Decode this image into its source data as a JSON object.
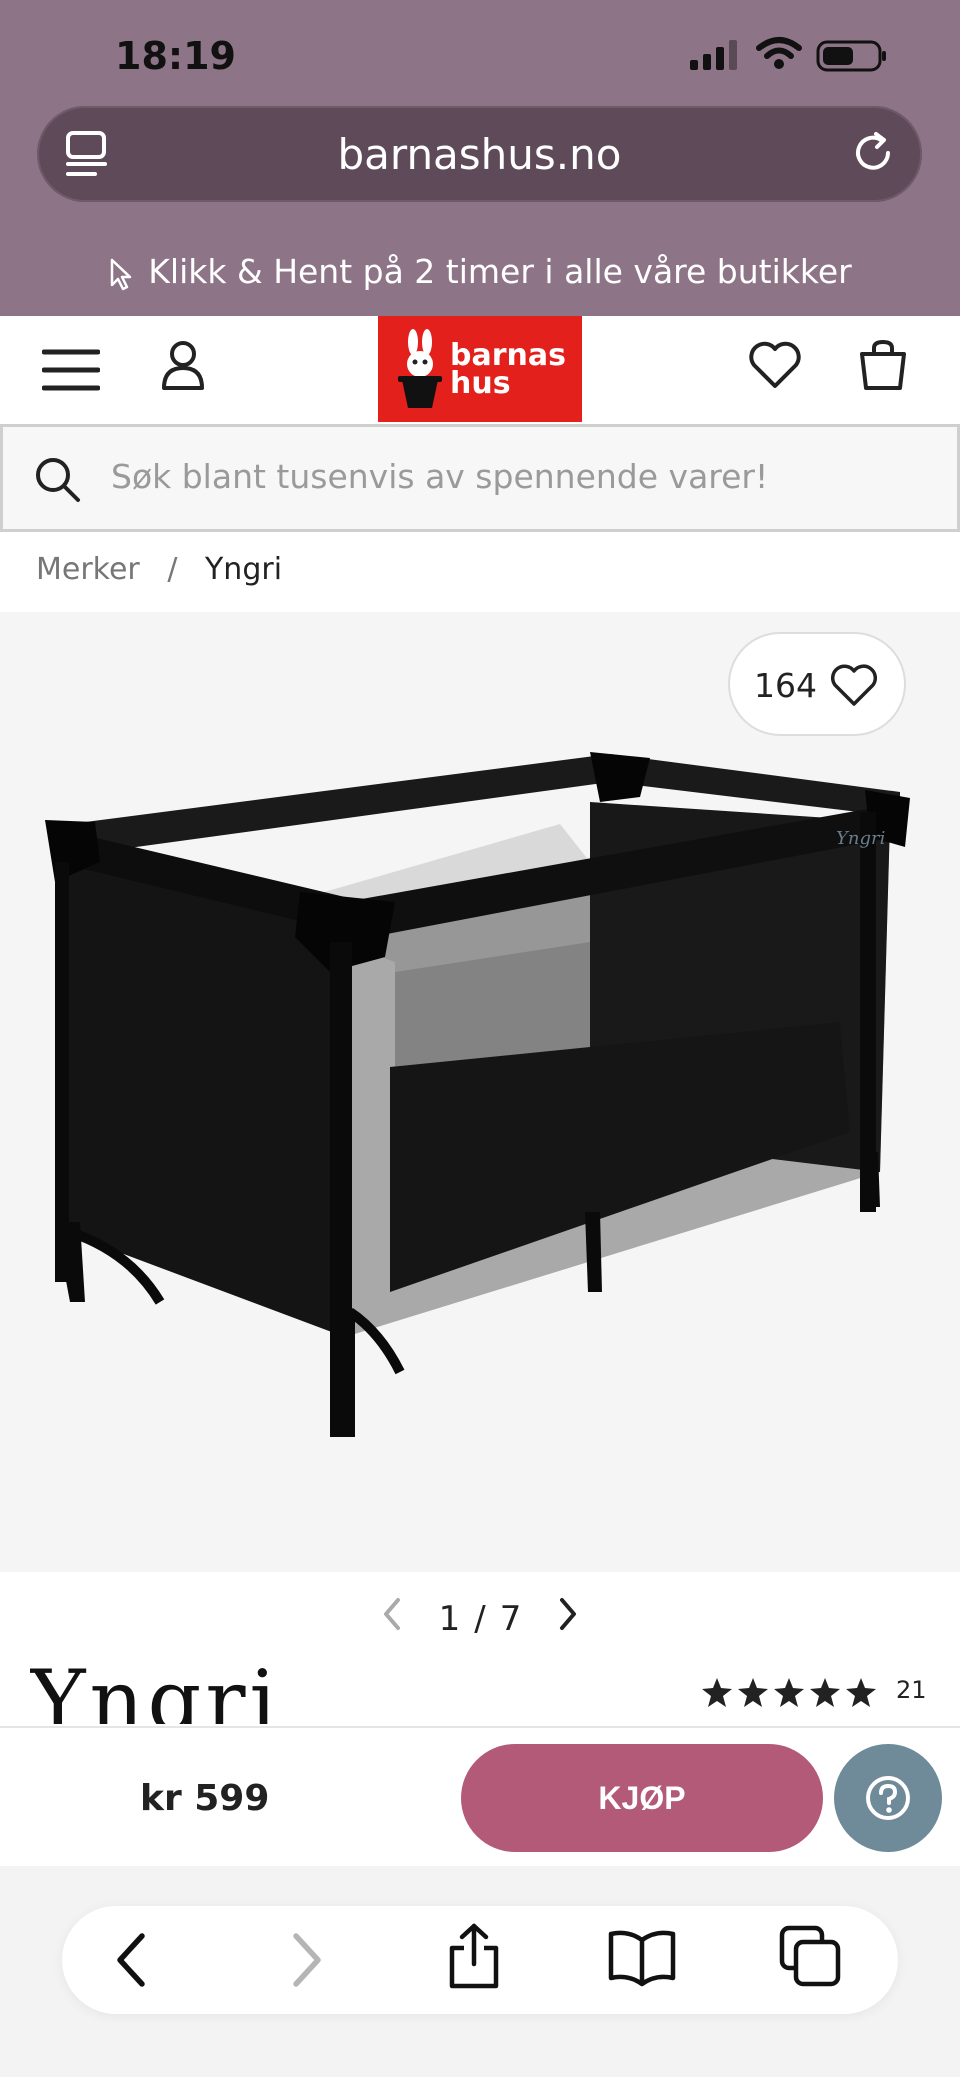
{
  "status_bar": {
    "time": "18:19"
  },
  "browser": {
    "url": "barnashus.no"
  },
  "promo": {
    "text": "Klikk & Hent på 2 timer i alle våre butikker"
  },
  "header": {
    "logo_line1": "barnas",
    "logo_line2": "hus"
  },
  "search": {
    "placeholder": "Søk blant tusenvis av spennende varer!"
  },
  "breadcrumb": {
    "items": [
      "Merker",
      "Yngri"
    ],
    "separator": "/"
  },
  "gallery": {
    "favorites_count": "164",
    "current": "1",
    "separator": "/",
    "total": "7",
    "logo_on_product": "Yngri"
  },
  "product": {
    "brand": "Yngri",
    "rating_count": "21",
    "rating_stars": 5,
    "price": "kr 599",
    "buy_label": "KJØP"
  },
  "colors": {
    "accent": "#b25a78",
    "help": "#6f8a98",
    "brand_red": "#e3201b",
    "top_bg": "#8e7487"
  }
}
